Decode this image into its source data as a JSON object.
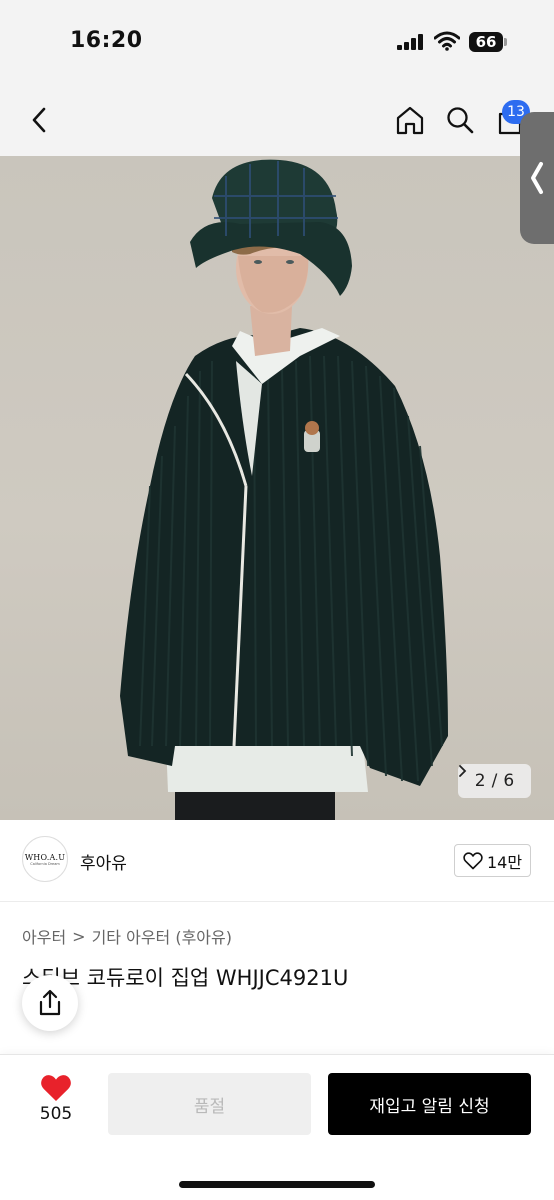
{
  "status_bar": {
    "time": "16:20",
    "battery": "66"
  },
  "nav": {
    "back_icon": "chevron-left-icon",
    "home_icon": "home-icon",
    "search_icon": "search-icon",
    "cart_icon": "shopping-bag-icon",
    "cart_badge": "13"
  },
  "hero": {
    "page_current": "2",
    "page_separator": "/",
    "page_total": "6"
  },
  "brand": {
    "logo_text": "WHO.A.U",
    "logo_subtext": "California Dream",
    "name": "후아유",
    "like_count": "14만"
  },
  "breadcrumb": {
    "category": "아우터",
    "separator": ">",
    "subcategory": "기타 아우터 (후아유)"
  },
  "product": {
    "title": "스티브 코듀로이 집업 WHJJC4921U"
  },
  "bottom_bar": {
    "wish_count": "505",
    "soldout_label": "품절",
    "restock_label": "재입고 알림 신청"
  },
  "colors": {
    "accent": "#2d6cf0",
    "heart": "#e8222b",
    "primary_button": "#000000",
    "disabled_button": "#efefef"
  }
}
